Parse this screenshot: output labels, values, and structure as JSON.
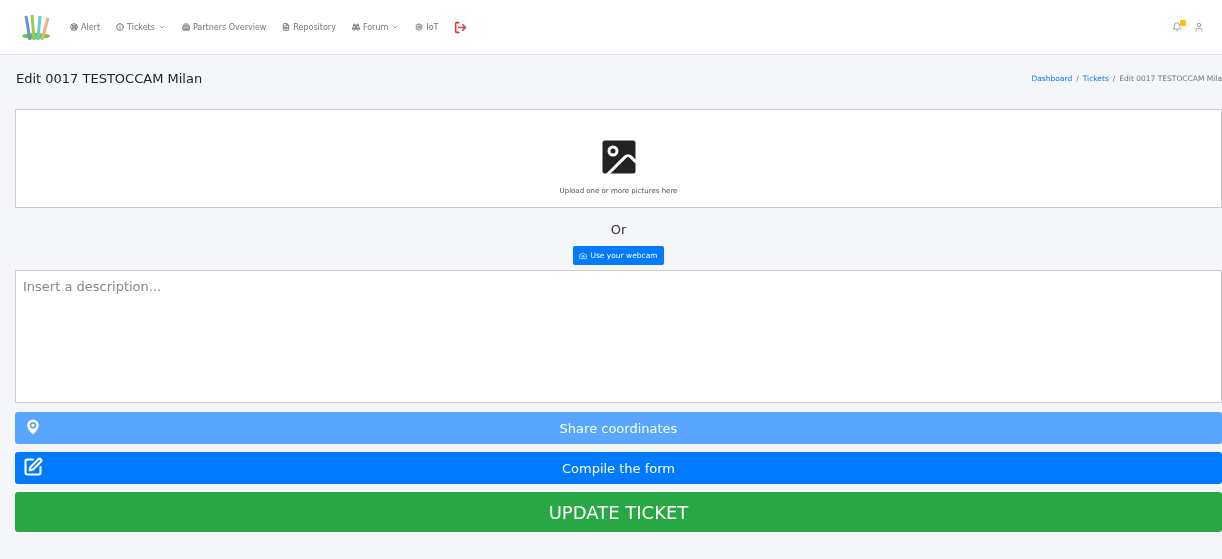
{
  "nav": {
    "items": [
      {
        "label": "Alert",
        "dropdown": false
      },
      {
        "label": "Tickets",
        "dropdown": true
      },
      {
        "label": "Partners Overview",
        "dropdown": false
      },
      {
        "label": "Repository",
        "dropdown": false
      },
      {
        "label": "Forum",
        "dropdown": true
      },
      {
        "label": "IoT",
        "dropdown": false
      }
    ],
    "notifications_badge": true
  },
  "page": {
    "title": "Edit 0017 TESTOCCAM Milan",
    "breadcrumb": [
      {
        "label": "Dashboard",
        "kind": "link"
      },
      {
        "label": "/",
        "kind": "separator"
      },
      {
        "label": "Tickets",
        "kind": "link"
      },
      {
        "label": "/",
        "kind": "separator"
      },
      {
        "label": "Edit 0017 TESTOCCAM Mila",
        "kind": "current"
      }
    ]
  },
  "upload": {
    "hint": "Upload one or more pictures here"
  },
  "or_text": "Or",
  "webcam_button": "Use your webcam",
  "description": {
    "placeholder": "Insert a description..."
  },
  "actions": [
    {
      "label": "Share coordinates",
      "kind": "location"
    },
    {
      "label": "Compile the form",
      "kind": "form"
    }
  ],
  "submit": "UPDATE TICKET"
}
